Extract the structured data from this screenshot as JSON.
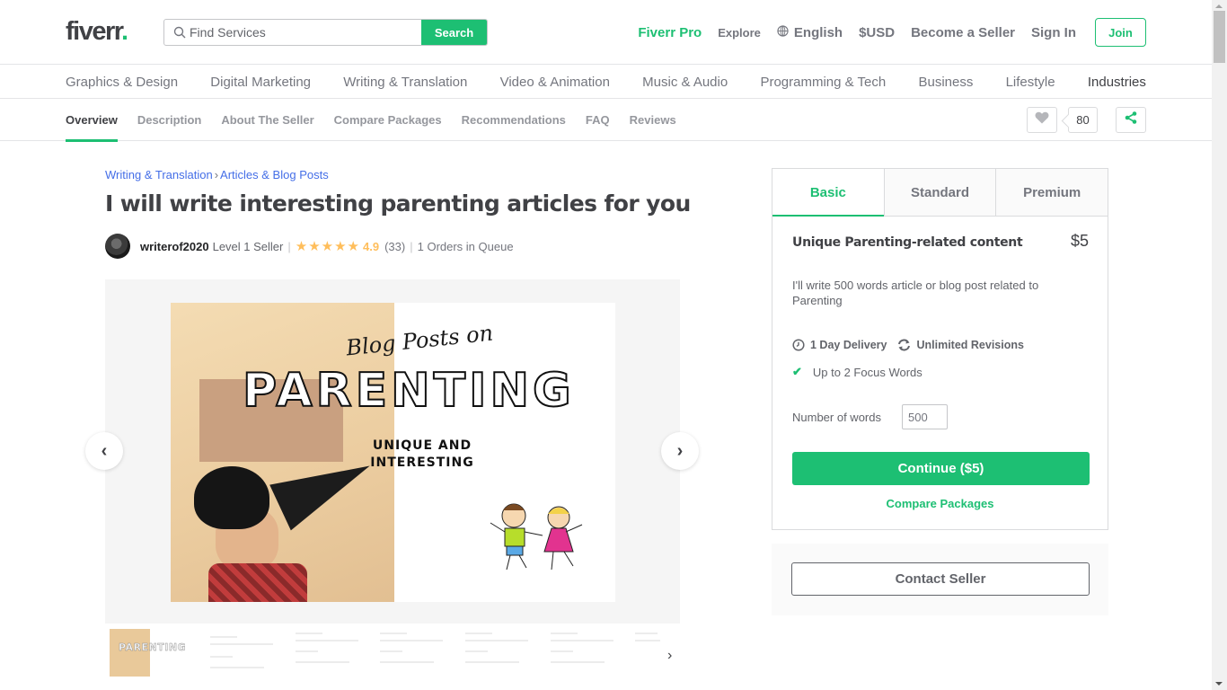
{
  "header": {
    "logo_text": "fiverr",
    "logo_dot": ".",
    "search": {
      "placeholder": "Find Services",
      "value": "",
      "button_label": "Search"
    },
    "nav": {
      "fiverr_pro": "Fiverr Pro",
      "explore": "Explore",
      "language": "English",
      "currency": "$USD",
      "become_seller": "Become a Seller",
      "sign_in": "Sign In",
      "join": "Join"
    }
  },
  "categories": [
    "Graphics & Design",
    "Digital Marketing",
    "Writing & Translation",
    "Video & Animation",
    "Music & Audio",
    "Programming & Tech",
    "Business",
    "Lifestyle",
    "Industries"
  ],
  "subnav": {
    "tabs": [
      "Overview",
      "Description",
      "About The Seller",
      "Compare Packages",
      "Recommendations",
      "FAQ",
      "Reviews"
    ],
    "active_tab": "Overview",
    "likes_count": "80"
  },
  "gig": {
    "breadcrumb": [
      "Writing & Translation",
      "Articles & Blog Posts"
    ],
    "breadcrumb_sep": "›",
    "title": "I will write interesting parenting articles for you",
    "seller": {
      "username": "writerof2020",
      "level": "Level 1 Seller",
      "stars_display": "★★★★★",
      "rating": "4.9",
      "reviews": "(33)",
      "queue": "1 Orders in Queue"
    },
    "image": {
      "script_text": "Blog Posts on",
      "headline": "PARENTING",
      "sub_line1": "UNIQUE AND",
      "sub_line2": "INTERESTING",
      "thumb_text": "PARENTING"
    }
  },
  "package": {
    "tabs": [
      "Basic",
      "Standard",
      "Premium"
    ],
    "active_tab": "Basic",
    "name": "Unique Parenting-related content",
    "price": "$5",
    "description": "I'll write 500 words article or blog post related to Parenting",
    "delivery": "1 Day Delivery",
    "revisions": "Unlimited Revisions",
    "features": [
      "Up to 2 Focus Words"
    ],
    "words_label": "Number of words",
    "words_value": "500",
    "continue_label": "Continue ($5)",
    "compare_label": "Compare Packages",
    "contact_label": "Contact Seller"
  },
  "colors": {
    "brand_green": "#1dbf73",
    "link_blue": "#446ee7",
    "star_yellow": "#ffbe5b",
    "text_dark": "#404145"
  }
}
